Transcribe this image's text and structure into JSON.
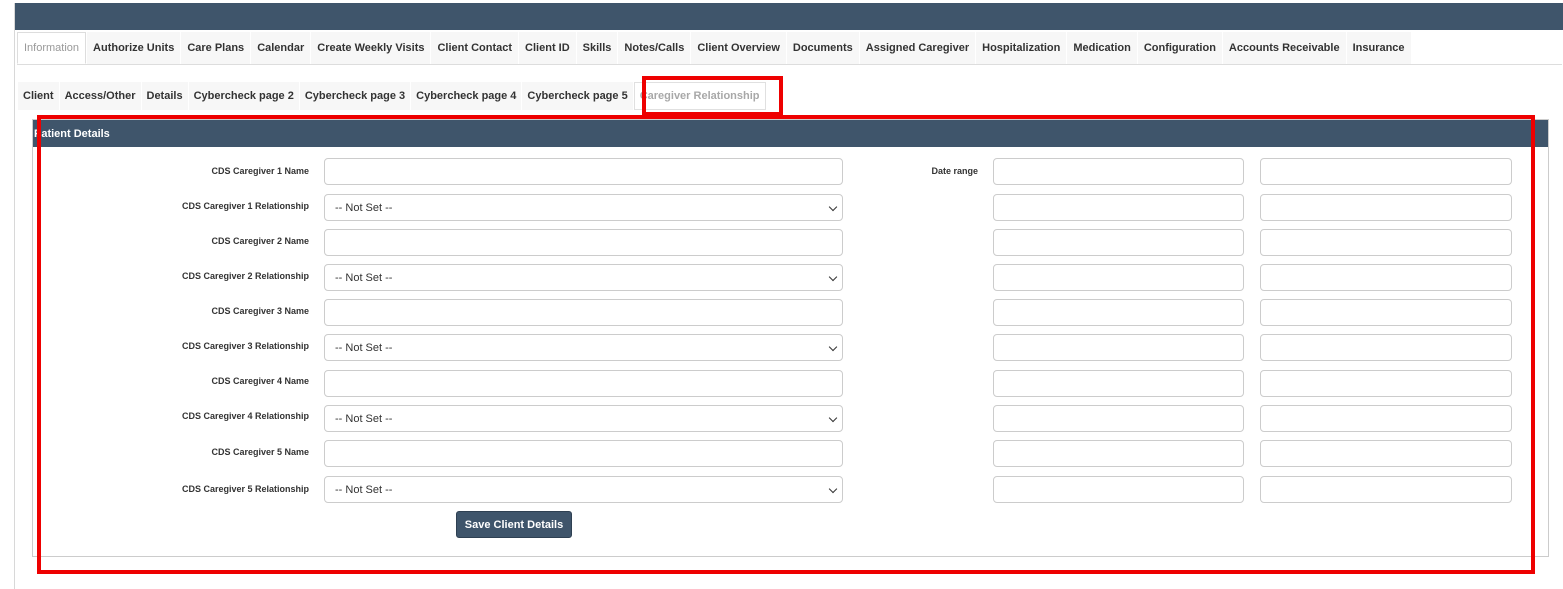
{
  "main_tabs": [
    "Information",
    "Authorize Units",
    "Care Plans",
    "Calendar",
    "Create Weekly Visits",
    "Client Contact",
    "Client ID",
    "Skills",
    "Notes/Calls",
    "Client Overview",
    "Documents",
    "Assigned Caregiver",
    "Hospitalization",
    "Medication",
    "Configuration",
    "Accounts Receivable",
    "Insurance"
  ],
  "sub_tabs": [
    "Client",
    "Access/Other",
    "Details",
    "Cybercheck page 2",
    "Cybercheck page 3",
    "Cybercheck page 4",
    "Cybercheck page 5",
    "Caregiver Relationship"
  ],
  "panel": {
    "title": "Patient Details",
    "date_range_label": "Date range",
    "fields": [
      {
        "label": "CDS Caregiver 1 Name",
        "type": "text",
        "value": ""
      },
      {
        "label": "CDS Caregiver 1 Relationship",
        "type": "select",
        "value": "-- Not Set --"
      },
      {
        "label": "CDS Caregiver 2 Name",
        "type": "text",
        "value": ""
      },
      {
        "label": "CDS Caregiver 2 Relationship",
        "type": "select",
        "value": "-- Not Set --"
      },
      {
        "label": "CDS Caregiver 3 Name",
        "type": "text",
        "value": ""
      },
      {
        "label": "CDS Caregiver 3 Relationship",
        "type": "select",
        "value": "-- Not Set --"
      },
      {
        "label": "CDS Caregiver 4 Name",
        "type": "text",
        "value": ""
      },
      {
        "label": "CDS Caregiver 4 Relationship",
        "type": "select",
        "value": "-- Not Set --"
      },
      {
        "label": "CDS Caregiver 5 Name",
        "type": "text",
        "value": ""
      },
      {
        "label": "CDS Caregiver 5 Relationship",
        "type": "select",
        "value": "-- Not Set --"
      }
    ],
    "save_label": "Save Client Details"
  },
  "colors": {
    "header": "#3f556b",
    "highlight": "#ee0000"
  }
}
